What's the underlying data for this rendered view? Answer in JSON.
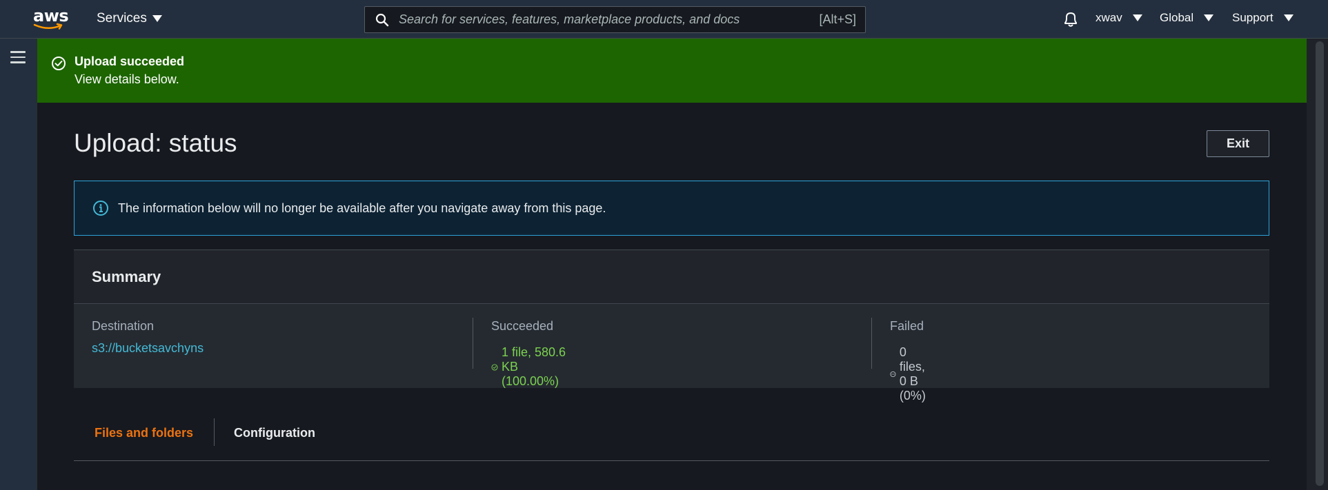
{
  "nav": {
    "logo": "aws",
    "services_label": "Services",
    "search_placeholder": "Search for services, features, marketplace products, and docs",
    "search_shortcut": "[Alt+S]",
    "user_label": "xwav",
    "region_label": "Global",
    "support_label": "Support"
  },
  "flash": {
    "title": "Upload succeeded",
    "message": "View details below.",
    "color": "#1d6500"
  },
  "page": {
    "title": "Upload: status",
    "exit_label": "Exit"
  },
  "info": {
    "text": "The information below will no longer be available after you navigate away from this page."
  },
  "summary": {
    "title": "Summary",
    "destination_label": "Destination",
    "destination_value": "s3://bucketsavchyns",
    "succeeded_label": "Succeeded",
    "succeeded_value": "1 file, 580.6 KB (100.00%)",
    "failed_label": "Failed",
    "failed_value": "0 files, 0 B (0%)"
  },
  "tabs": [
    {
      "label": "Files and folders",
      "active": true
    },
    {
      "label": "Configuration",
      "active": false
    }
  ],
  "colors": {
    "accent_orange": "#ec7211",
    "link_blue": "#44b9d6",
    "success_green": "#7bd250",
    "info_border": "#2ea2d9"
  }
}
